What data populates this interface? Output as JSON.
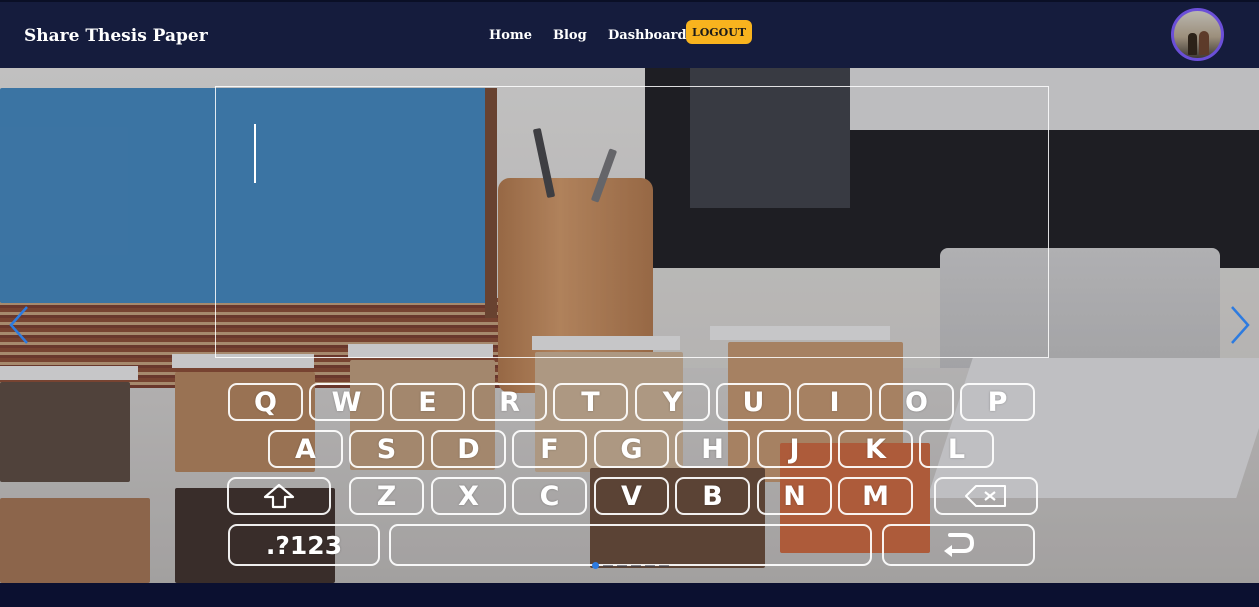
{
  "navbar": {
    "brand": "Share Thesis Paper",
    "links": {
      "home": "Home",
      "blog": "Blog",
      "dashboard": "Dashboard"
    },
    "logout_label": "LOGOUT"
  },
  "keyboard": {
    "row1": [
      "Q",
      "W",
      "E",
      "R",
      "T",
      "Y",
      "U",
      "I",
      "O",
      "P"
    ],
    "row2": [
      "A",
      "S",
      "D",
      "F",
      "G",
      "H",
      "J",
      "K",
      "L"
    ],
    "row3": [
      "Z",
      "X",
      "C",
      "V",
      "B",
      "N",
      "M"
    ],
    "symbols_label": ".?123"
  },
  "colors": {
    "navbar": "#151c3d",
    "logout_button": "#f8b31e",
    "avatar_ring": "#6b4fd8",
    "slider_arrow": "#2d7be0"
  },
  "icons": {
    "prev": "chevron-left-icon",
    "next": "chevron-right-icon",
    "shift": "shift-arrow-icon",
    "backspace": "backspace-icon",
    "enter": "enter-return-icon"
  }
}
